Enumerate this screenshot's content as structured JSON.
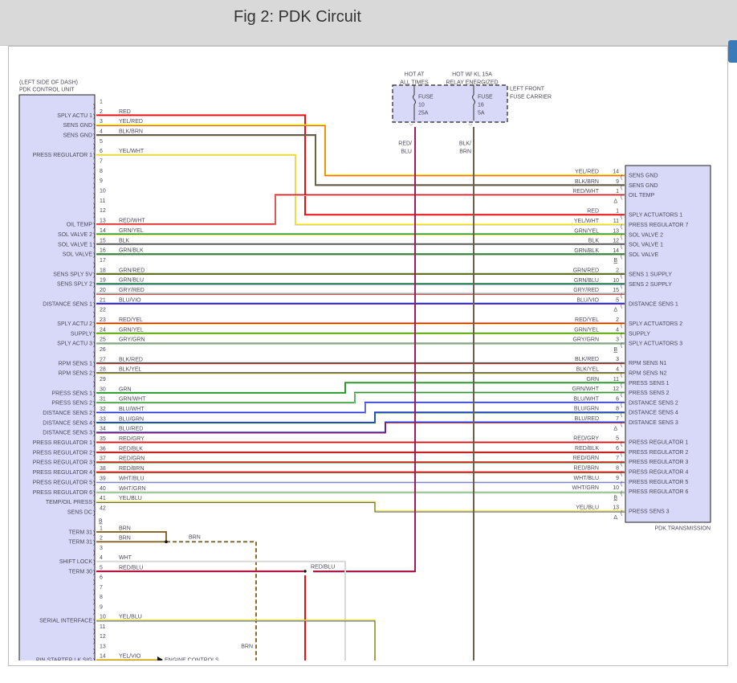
{
  "title": "Fig 2: PDK Circuit",
  "colors": {
    "RED": "#e81010",
    "YEL": "#f2e000",
    "BLK": "#5a5a5a",
    "BRN": "#8b6b2a",
    "GRN": "#2a9a2a",
    "BLU": "#2233dd",
    "GRY": "#a8a8a8",
    "WHT": "#d8d8d8",
    "VIO": "#8a34cc",
    "box_fill": "#d8d8f8",
    "accent": "#3a7ab8"
  },
  "control_unit": {
    "location": "(LEFT SIDE OF DASH)",
    "name": "PDK CONTROL UNIT",
    "pins": [
      {
        "pin": "1",
        "label": "",
        "wire": ""
      },
      {
        "pin": "2",
        "label": "SPLY ACTU 1",
        "wire": "RED"
      },
      {
        "pin": "3",
        "label": "SENS GND",
        "wire": "YEL/RED"
      },
      {
        "pin": "4",
        "label": "SENS GND",
        "wire": "BLK/BRN"
      },
      {
        "pin": "5",
        "label": "",
        "wire": ""
      },
      {
        "pin": "6",
        "label": "PRESS REGULATOR 1",
        "wire": "YEL/WHT"
      },
      {
        "pin": "7",
        "label": "",
        "wire": ""
      },
      {
        "pin": "8",
        "label": "",
        "wire": ""
      },
      {
        "pin": "9",
        "label": "",
        "wire": ""
      },
      {
        "pin": "10",
        "label": "",
        "wire": ""
      },
      {
        "pin": "11",
        "label": "",
        "wire": ""
      },
      {
        "pin": "12",
        "label": "",
        "wire": ""
      },
      {
        "pin": "13",
        "label": "OIL TEMP",
        "wire": "RED/WHT"
      },
      {
        "pin": "14",
        "label": "SOL VALVE 2",
        "wire": "GRN/YEL"
      },
      {
        "pin": "15",
        "label": "SOL VALVE 1",
        "wire": "BLK"
      },
      {
        "pin": "16",
        "label": "SOL VALVE",
        "wire": "GRN/BLK"
      },
      {
        "pin": "17",
        "label": "",
        "wire": ""
      },
      {
        "pin": "18",
        "label": "SENS SPLY 5V",
        "wire": "GRN/RED"
      },
      {
        "pin": "19",
        "label": "SENS SPLY 2",
        "wire": "GRN/BLU"
      },
      {
        "pin": "20",
        "label": "",
        "wire": "GRY/RED"
      },
      {
        "pin": "21",
        "label": "DISTANCE SENS 1",
        "wire": "BLU/VIO"
      },
      {
        "pin": "22",
        "label": "",
        "wire": ""
      },
      {
        "pin": "23",
        "label": "SPLY ACTU 2",
        "wire": "RED/YEL"
      },
      {
        "pin": "24",
        "label": "SUPPLY",
        "wire": "GRN/YEL"
      },
      {
        "pin": "25",
        "label": "SPLY ACTU 3",
        "wire": "GRY/GRN"
      },
      {
        "pin": "26",
        "label": "",
        "wire": ""
      },
      {
        "pin": "27",
        "label": "RPM SENS 1",
        "wire": "BLK/RED"
      },
      {
        "pin": "28",
        "label": "RPM SENS 2",
        "wire": "BLK/YEL"
      },
      {
        "pin": "29",
        "label": "",
        "wire": ""
      },
      {
        "pin": "30",
        "label": "PRESS SENS 1",
        "wire": "GRN"
      },
      {
        "pin": "31",
        "label": "PRESS SENS 2",
        "wire": "GRN/WHT"
      },
      {
        "pin": "32",
        "label": "DISTANCE SENS 2",
        "wire": "BLU/WHT"
      },
      {
        "pin": "33",
        "label": "DISTANCE SENS 4",
        "wire": "BLU/GRN"
      },
      {
        "pin": "34",
        "label": "DISTANCE SENS 3",
        "wire": "BLU/RED"
      },
      {
        "pin": "35",
        "label": "PRESS REGULATOR 1",
        "wire": "RED/GRY"
      },
      {
        "pin": "36",
        "label": "PRESS REGULATOR 2",
        "wire": "RED/BLK"
      },
      {
        "pin": "37",
        "label": "PRESS REGULATOR 3",
        "wire": "RED/GRN"
      },
      {
        "pin": "38",
        "label": "PRESS REGULATOR 4",
        "wire": "RED/BRN"
      },
      {
        "pin": "39",
        "label": "PRESS REGULATOR 5",
        "wire": "WHT/BLU"
      },
      {
        "pin": "40",
        "label": "PRESS REGULATOR 6",
        "wire": "WHT/GRN"
      },
      {
        "pin": "41",
        "label": "TEMP/OIL PRESS",
        "wire": "YEL/BLU"
      },
      {
        "pin": "42",
        "label": "SENS DC",
        "wire": ""
      }
    ],
    "connector_b": {
      "name": "B",
      "pins": [
        {
          "pin": "1",
          "label": "TERM 31",
          "wire": "BRN"
        },
        {
          "pin": "2",
          "label": "TERM 31",
          "wire": "BRN"
        },
        {
          "pin": "3",
          "label": "",
          "wire": ""
        },
        {
          "pin": "4",
          "label": "SHIFT LOCK",
          "wire": "WHT"
        },
        {
          "pin": "5",
          "label": "TERM 30",
          "wire": "RED/BLU"
        },
        {
          "pin": "6",
          "label": "",
          "wire": ""
        },
        {
          "pin": "7",
          "label": "",
          "wire": ""
        },
        {
          "pin": "8",
          "label": "",
          "wire": ""
        },
        {
          "pin": "9",
          "label": "",
          "wire": ""
        },
        {
          "pin": "10",
          "label": "SERIAL INTERFACE",
          "wire": "YEL/BLU"
        },
        {
          "pin": "11",
          "label": "",
          "wire": ""
        },
        {
          "pin": "12",
          "label": "",
          "wire": ""
        },
        {
          "pin": "13",
          "label": "",
          "wire": ""
        },
        {
          "pin": "14",
          "label": "PIN STARTER LK SIG",
          "wire": "YEL/VIO"
        }
      ],
      "brn_splice_label": "BRN",
      "brn_lower_label": "BRN",
      "red_blu_splice_label": "RED/BLU",
      "engine_controls": "ENGINE CONTROLS"
    }
  },
  "transmission": {
    "name": "PDK TRANSMISSION",
    "rows": [
      {
        "pin": "14",
        "wire": "YEL/RED",
        "label": "SENS GND",
        "from": "3"
      },
      {
        "pin": "9",
        "wire": "BLK/BRN",
        "label": "SENS GND",
        "from": "4"
      },
      {
        "pin": "1",
        "wire": "RED/WHT",
        "label": "OIL TEMP",
        "from": "13"
      },
      {
        "pin": "A",
        "wire": "",
        "label": ""
      },
      {
        "pin": "1",
        "wire": "RED",
        "label": "SPLY ACTUATORS 1",
        "from": "2"
      },
      {
        "pin": "11",
        "wire": "YEL/WHT",
        "label": "PRESS REGULATOR 7",
        "from": "6"
      },
      {
        "pin": "13",
        "wire": "GRN/YEL",
        "label": "SOL VALVE 2",
        "from": "14"
      },
      {
        "pin": "12",
        "wire": "BLK",
        "label": "SOL VALVE 1",
        "from": "15"
      },
      {
        "pin": "14",
        "wire": "GRN/BLK",
        "label": "SOL VALVE",
        "from": "16"
      },
      {
        "pin": "B",
        "wire": "",
        "label": ""
      },
      {
        "pin": "2",
        "wire": "GRN/RED",
        "label": "SENS 1 SUPPLY",
        "from": "18"
      },
      {
        "pin": "10",
        "wire": "GRN/BLU",
        "label": "SENS 2 SUPPLY",
        "from": "19"
      },
      {
        "pin": "15",
        "wire": "GRY/RED",
        "label": "",
        "from": "20"
      },
      {
        "pin": "5",
        "wire": "BLU/VIO",
        "label": "DISTANCE SENS 1",
        "from": "21"
      },
      {
        "pin": "A",
        "wire": "",
        "label": ""
      },
      {
        "pin": "2",
        "wire": "RED/YEL",
        "label": "SPLY ACTUATORS 2",
        "from": "23"
      },
      {
        "pin": "4",
        "wire": "GRN/YEL",
        "label": "SUPPLY",
        "from": "24"
      },
      {
        "pin": "3",
        "wire": "GRY/GRN",
        "label": "SPLY ACTUATORS 3",
        "from": "25"
      },
      {
        "pin": "B",
        "wire": "",
        "label": ""
      },
      {
        "pin": "3",
        "wire": "BLK/RED",
        "label": "RPM SENS N1",
        "from": "27"
      },
      {
        "pin": "4",
        "wire": "BLK/YEL",
        "label": "RPM SENS N2",
        "from": "28"
      },
      {
        "pin": "11",
        "wire": "GRN",
        "label": "PRESS SENS 1",
        "from": "30"
      },
      {
        "pin": "12",
        "wire": "GRN/WHT",
        "label": "PRESS SENS 2",
        "from": "31"
      },
      {
        "pin": "6",
        "wire": "BLU/WHT",
        "label": "DISTANCE SENS 2",
        "from": "32"
      },
      {
        "pin": "8",
        "wire": "BLU/GRN",
        "label": "DISTANCE SENS 4",
        "from": "33"
      },
      {
        "pin": "7",
        "wire": "BLU/RED",
        "label": "DISTANCE SENS 3",
        "from": "34"
      },
      {
        "pin": "A",
        "wire": "",
        "label": ""
      },
      {
        "pin": "5",
        "wire": "RED/GRY",
        "label": "PRESS REGULATOR 1",
        "from": "35"
      },
      {
        "pin": "6",
        "wire": "RED/BLK",
        "label": "PRESS REGULATOR 2",
        "from": "36"
      },
      {
        "pin": "7",
        "wire": "RED/GRN",
        "label": "PRESS REGULATOR 3",
        "from": "37"
      },
      {
        "pin": "8",
        "wire": "RED/BRN",
        "label": "PRESS REGULATOR 4",
        "from": "38"
      },
      {
        "pin": "9",
        "wire": "WHT/BLU",
        "label": "PRESS REGULATOR 5",
        "from": "39"
      },
      {
        "pin": "10",
        "wire": "WHT/GRN",
        "label": "PRESS REGULATOR 6",
        "from": "40"
      },
      {
        "pin": "B",
        "wire": "",
        "label": ""
      },
      {
        "pin": "13",
        "wire": "YEL/BLU",
        "label": "PRESS SENS 3",
        "from": "41"
      },
      {
        "pin": "A",
        "wire": "",
        "label": ""
      }
    ]
  },
  "fuse_carrier": {
    "name": [
      "LEFT FRONT",
      "FUSE CARRIER"
    ],
    "fuses": [
      {
        "hot": [
          "HOT AT",
          "ALL TIMES"
        ],
        "lines": [
          "FUSE",
          "10",
          "25A"
        ],
        "wire": [
          "RED/",
          "BLU"
        ]
      },
      {
        "hot": [
          "HOT W/ KL 15A",
          "RELAY ENERGIZED"
        ],
        "lines": [
          "FUSE",
          "16",
          "5A"
        ],
        "wire": [
          "BLK/",
          "BRN"
        ]
      }
    ]
  }
}
